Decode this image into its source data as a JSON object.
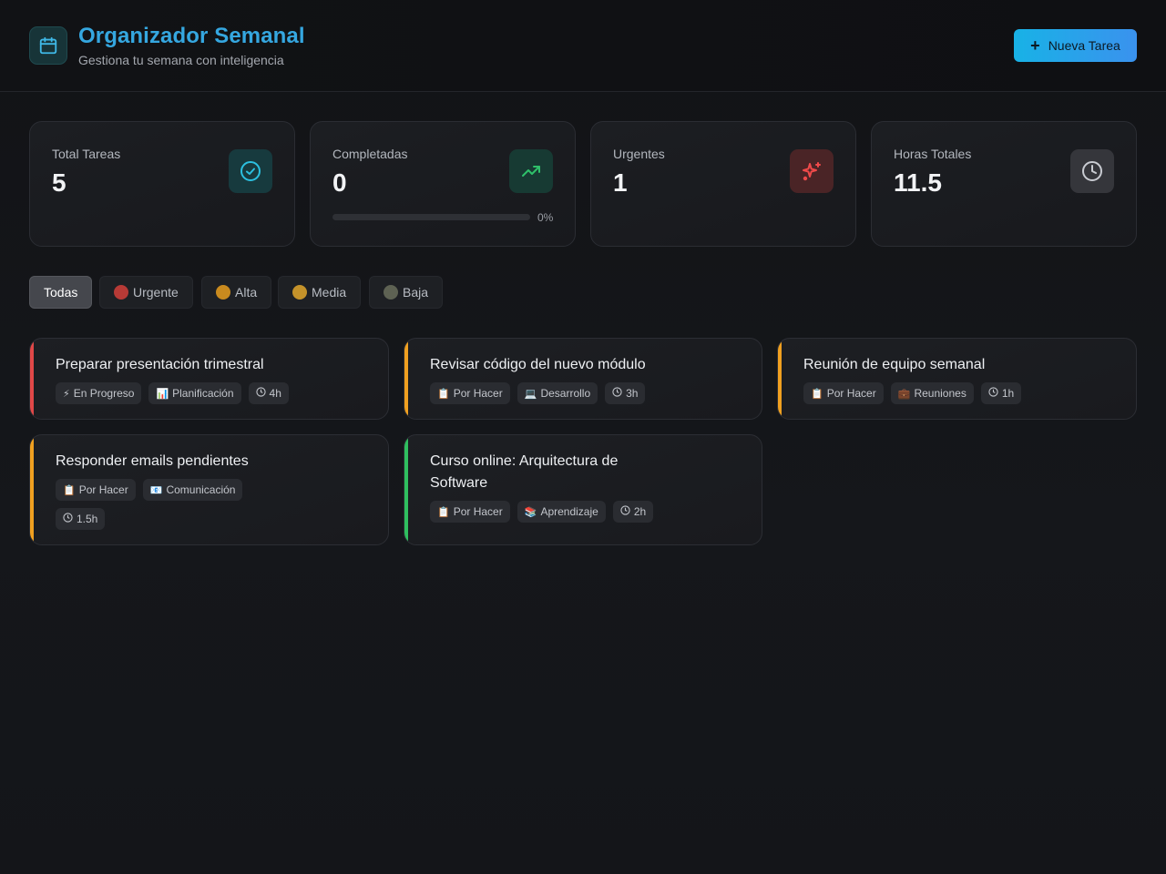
{
  "header": {
    "title": "Organizador Semanal",
    "subtitle": "Gestiona tu semana con inteligencia",
    "new_task_label": "Nueva Tarea"
  },
  "stats": {
    "total": {
      "label": "Total Tareas",
      "value": "5"
    },
    "completed": {
      "label": "Completadas",
      "value": "0",
      "progress_pct": "0%",
      "progress_fraction": 0
    },
    "urgent": {
      "label": "Urgentes",
      "value": "1"
    },
    "hours": {
      "label": "Horas Totales",
      "value": "11.5"
    }
  },
  "filters": [
    {
      "label": "Todas",
      "active": true
    },
    {
      "label": "Urgente",
      "color": "#c0392b"
    },
    {
      "label": "Alta",
      "color": "#e0951f"
    },
    {
      "label": "Media",
      "color": "#d49a22"
    },
    {
      "label": "Baja",
      "color": "#6b6f5e"
    }
  ],
  "tasks": [
    {
      "title": "Preparar presentación trimestral",
      "priority_color": "#e04848",
      "status": "En Progreso",
      "status_icon": "⚡",
      "category": "Planificación",
      "category_icon": "📊",
      "hours": "4h"
    },
    {
      "title": "Revisar código del nuevo módulo",
      "priority_color": "#f0a020",
      "status": "Por Hacer",
      "status_icon": "📋",
      "category": "Desarrollo",
      "category_icon": "💻",
      "hours": "3h"
    },
    {
      "title": "Reunión de equipo semanal",
      "priority_color": "#f0a020",
      "status": "Por Hacer",
      "status_icon": "📋",
      "category": "Reuniones",
      "category_icon": "💼",
      "hours": "1h"
    },
    {
      "title": "Responder emails pendientes",
      "priority_color": "#f0a020",
      "status": "Por Hacer",
      "status_icon": "📋",
      "category": "Comunicación",
      "category_icon": "📧",
      "hours": "1.5h"
    },
    {
      "title": "Curso online: Arquitectura de Software",
      "priority_color": "#2fbf5f",
      "status": "Por Hacer",
      "status_icon": "📋",
      "category": "Aprendizaje",
      "category_icon": "📚",
      "hours": "2h"
    }
  ],
  "colors": {
    "accent": "#35a7e0",
    "urgent": "#e04848",
    "high": "#f0a020",
    "low": "#2fbf5f"
  }
}
